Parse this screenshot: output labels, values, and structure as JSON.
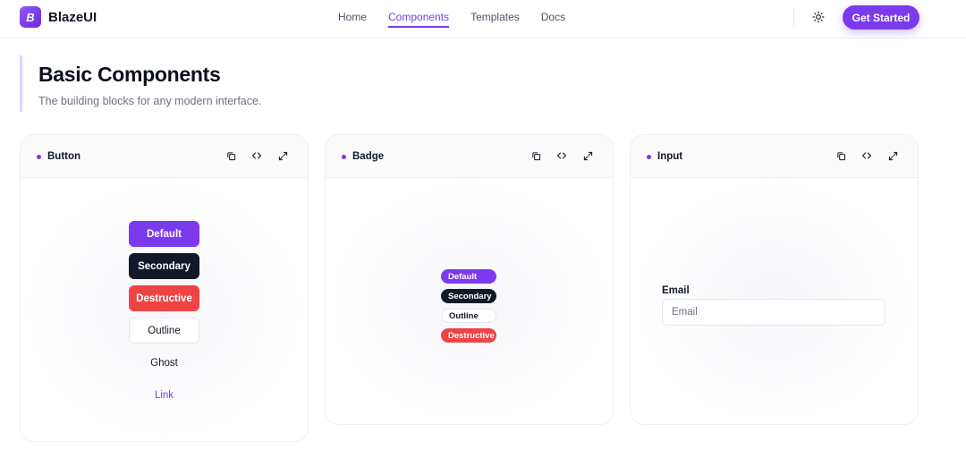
{
  "header": {
    "logo_letter": "B",
    "brand": "BlazeUI",
    "nav": [
      {
        "label": "Home",
        "active": false
      },
      {
        "label": "Components",
        "active": true
      },
      {
        "label": "Templates",
        "active": false
      },
      {
        "label": "Docs",
        "active": false
      }
    ],
    "theme_icon": "sun-icon",
    "cta_label": "Get Started"
  },
  "section": {
    "title": "Basic Components",
    "subtitle": "The building blocks for any modern interface."
  },
  "cards": {
    "button": {
      "title": "Button",
      "items": [
        "Default",
        "Secondary",
        "Destructive",
        "Outline",
        "Ghost",
        "Link"
      ]
    },
    "badge": {
      "title": "Badge",
      "items": [
        "Default",
        "Secondary",
        "Outline",
        "Destructive"
      ]
    },
    "input": {
      "title": "Input",
      "label": "Email",
      "placeholder": "Email",
      "value": ""
    }
  },
  "card_tools": [
    "copy-icon",
    "code-icon",
    "expand-icon"
  ],
  "colors": {
    "accent": "#7c3aed",
    "secondary": "#111827",
    "destructive": "#ef4444"
  }
}
